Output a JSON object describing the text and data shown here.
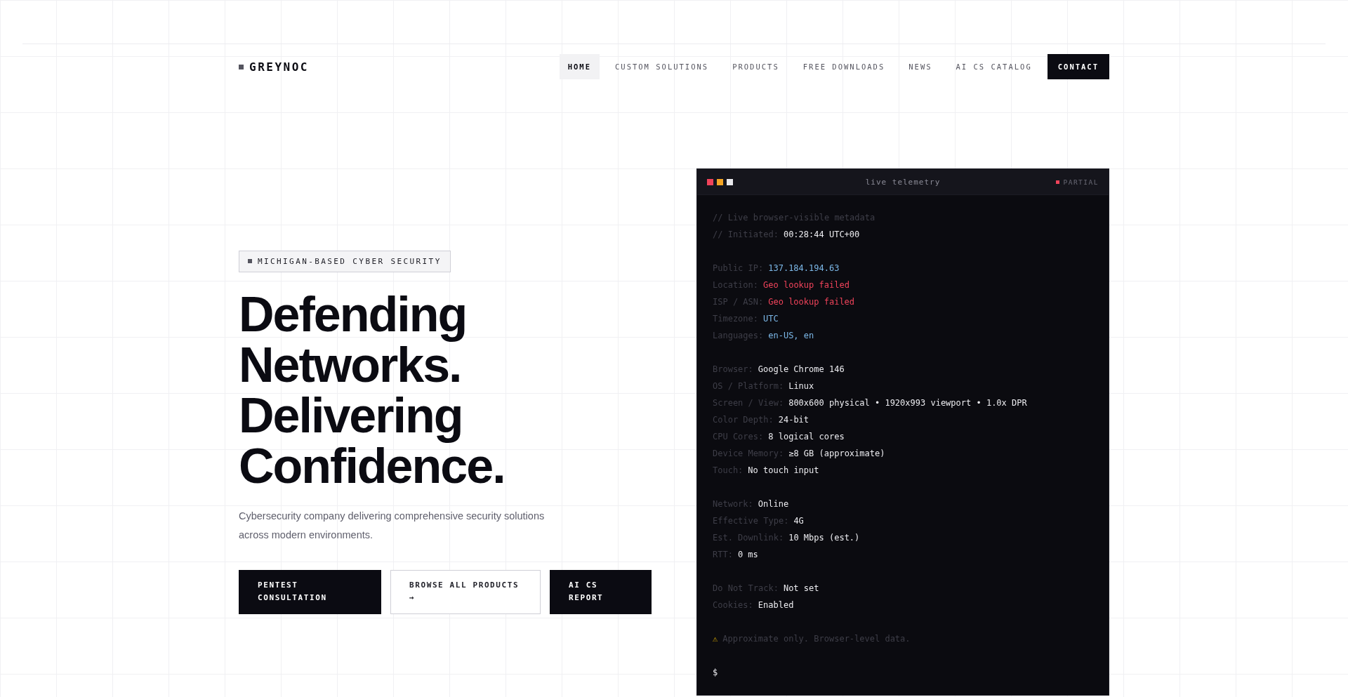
{
  "brand": {
    "name": "GREYNOC"
  },
  "nav": [
    {
      "label": "HOME",
      "selected": true,
      "kind": "link"
    },
    {
      "label": "CUSTOM SOLUTIONS",
      "selected": false,
      "kind": "link"
    },
    {
      "label": "PRODUCTS",
      "selected": false,
      "kind": "link"
    },
    {
      "label": "FREE DOWNLOADS",
      "selected": false,
      "kind": "link"
    },
    {
      "label": "NEWS",
      "selected": false,
      "kind": "link"
    },
    {
      "label": "AI CS CATALOG",
      "selected": false,
      "kind": "link"
    },
    {
      "label": "CONTACT",
      "selected": false,
      "kind": "cta"
    }
  ],
  "hero": {
    "badge": "MICHIGAN-BASED CYBER SECURITY",
    "headline": [
      "Defending",
      "Networks.",
      "Delivering",
      "Confidence."
    ],
    "description": "Cybersecurity company delivering comprehensive security solutions across modern environments.",
    "buttons": [
      {
        "label": "PENTEST CONSULTATION",
        "kind": "primary"
      },
      {
        "label": "BROWSE ALL PRODUCTS →",
        "kind": "outline"
      },
      {
        "label": "AI CS REPORT",
        "kind": "primary"
      }
    ]
  },
  "terminal": {
    "title": "live telemetry",
    "dots": [
      {
        "color": "#f0435a"
      },
      {
        "color": "#f5a524"
      },
      {
        "color": "#e8e8ec"
      }
    ],
    "status": {
      "label": "PARTIAL",
      "color": "#f0435a"
    },
    "groups": [
      [
        {
          "label": "// Live browser-visible metadata",
          "kind": "comment"
        },
        {
          "label": "// Initiated:",
          "value": "00:28:44 UTC+00",
          "kind": "plain"
        }
      ],
      [
        {
          "label": "Public IP:",
          "value": "137.184.194.63",
          "kind": "info"
        },
        {
          "label": "Location:",
          "value": "Geo lookup failed",
          "kind": "error"
        },
        {
          "label": "ISP / ASN:",
          "value": "Geo lookup failed",
          "kind": "error"
        },
        {
          "label": "Timezone:",
          "value": "UTC",
          "kind": "info"
        },
        {
          "label": "Languages:",
          "value": "en-US, en",
          "kind": "info"
        }
      ],
      [
        {
          "label": "Browser:",
          "value": "Google Chrome 146",
          "kind": "plain"
        },
        {
          "label": "OS / Platform:",
          "value": "Linux",
          "kind": "plain"
        },
        {
          "label": "Screen / View:",
          "value": "800x600 physical • 1920x993 viewport • 1.0x DPR",
          "kind": "plain"
        },
        {
          "label": "Color Depth:",
          "value": "24-bit",
          "kind": "plain"
        },
        {
          "label": "CPU Cores:",
          "value": "8 logical cores",
          "kind": "plain"
        },
        {
          "label": "Device Memory:",
          "value": "≥8 GB (approximate)",
          "kind": "plain"
        },
        {
          "label": "Touch:",
          "value": "No touch input",
          "kind": "plain"
        }
      ],
      [
        {
          "label": "Network:",
          "value": "Online",
          "kind": "plain"
        },
        {
          "label": "Effective Type:",
          "value": "4G",
          "kind": "plain"
        },
        {
          "label": "Est. Downlink:",
          "value": "10 Mbps (est.)",
          "kind": "plain"
        },
        {
          "label": "RTT:",
          "value": "0 ms",
          "kind": "plain"
        }
      ],
      [
        {
          "label": "Do Not Track:",
          "value": "Not set",
          "kind": "plain"
        },
        {
          "label": "Cookies:",
          "value": "Enabled",
          "kind": "plain"
        }
      ]
    ],
    "note": {
      "glyph": "⚠",
      "text": "Approximate only. Browser-level data."
    },
    "prompt": "$"
  }
}
